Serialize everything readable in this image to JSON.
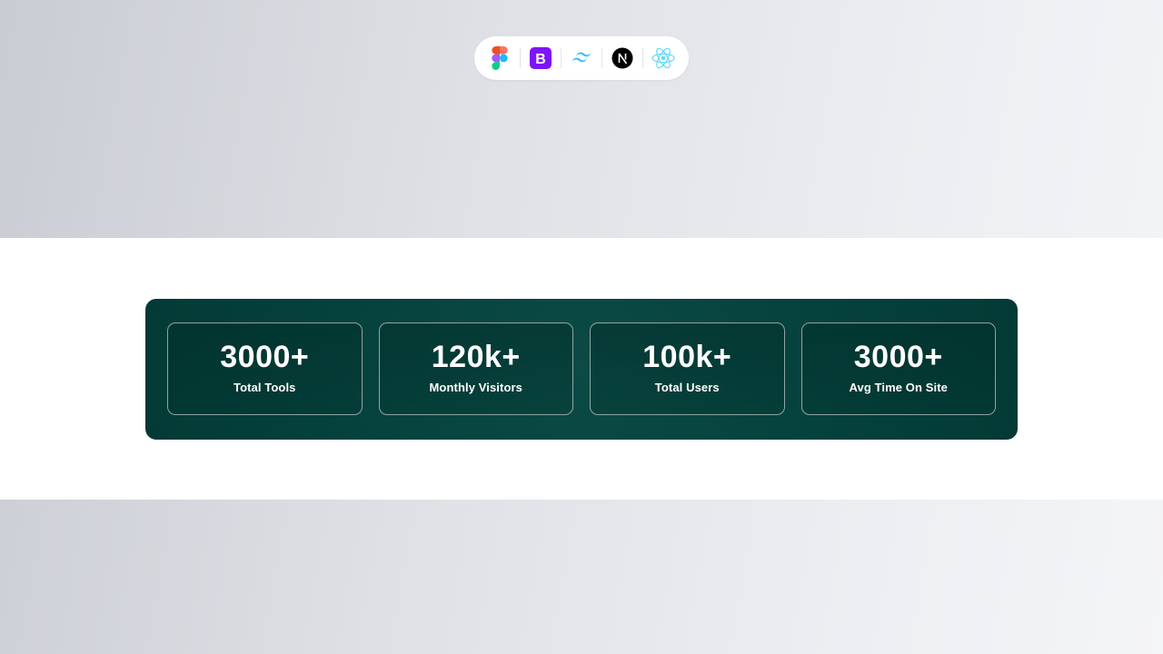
{
  "tech_stack": {
    "icons": [
      "figma-icon",
      "bootstrap-icon",
      "tailwind-icon",
      "nextjs-icon",
      "react-icon"
    ]
  },
  "stats": {
    "items": [
      {
        "value": "3000+",
        "label": "Total Tools"
      },
      {
        "value": "120k+",
        "label": "Monthly Visitors"
      },
      {
        "value": "100k+",
        "label": "Total Users"
      },
      {
        "value": "3000+",
        "label": "Avg Time On Site"
      }
    ]
  },
  "colors": {
    "panel": "#05413c",
    "bootstrap": "#7e13f8",
    "tailwind": "#38bdf8",
    "react": "#61dafb"
  }
}
